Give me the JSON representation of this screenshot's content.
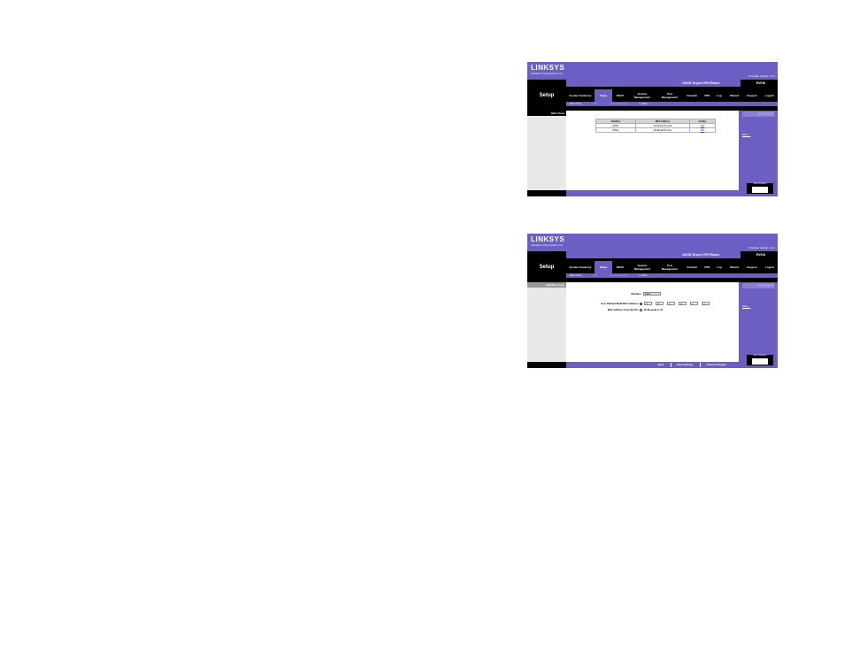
{
  "screenshot1": {
    "brand": "LINKSYS",
    "brand_sub": "A Division of Cisco Systems, Inc.",
    "firmware": "Firmware Version: 1.1.0",
    "product": "10/100 16-port VPN Router",
    "model": "RV016",
    "section": "Setup",
    "tabs": [
      "System Summary",
      "Setup",
      "DHCP",
      "System Management",
      "Port Management",
      "Firewall",
      "VPN",
      "Log",
      "Wizard",
      "Support",
      "Logout"
    ],
    "subtabs": [
      "MAC Clone",
      "DMZ",
      "Advanced Routing",
      ">> More..."
    ],
    "left_label": "MAC Clone",
    "table": {
      "headers": [
        "Interface",
        "MAC Address",
        "Config."
      ],
      "rows": [
        {
          "interface": "WAN1",
          "mac": "00:0E:aa:bb:cc:dd",
          "config": "Edit"
        },
        {
          "interface": "WAN2",
          "mac": "00:0E:aa:bb:cc:de",
          "config": "Edit"
        }
      ]
    },
    "sitemap": "SITEMAP",
    "more_link": "More...",
    "cisco_label": "Cisco Systems"
  },
  "screenshot2": {
    "brand": "LINKSYS",
    "brand_sub": "A Division of Cisco Systems, Inc.",
    "firmware": "Firmware Version: 1.1.0",
    "product": "10/100 16-port VPN Router",
    "model": "RV016",
    "section": "Setup",
    "tabs": [
      "System Summary",
      "Setup",
      "DHCP",
      "System Management",
      "Port Management",
      "Firewall",
      "VPN",
      "Log",
      "Wizard",
      "Support",
      "Logout"
    ],
    "subtabs": [
      "MAC Clone",
      "DMZ",
      "Advanced Routing",
      ">> More..."
    ],
    "left_label": "Edit MAC Clone",
    "interface_label": "Interface :",
    "interface_value": "WAN1",
    "default_label": "User Defined WAN MAC Address:",
    "mac_fields": [
      "00",
      "0E",
      "aa",
      "bb",
      "cc",
      "dd"
    ],
    "pc_label": "MAC Address from this PC:",
    "pc_mac": "00-0E-aa-bb-cc-df",
    "buttons": [
      "Back",
      "Save Settings",
      "Cancel Changes"
    ],
    "sitemap": "SITEMAP",
    "more_link": "More...",
    "cisco_label": "Cisco Systems"
  }
}
